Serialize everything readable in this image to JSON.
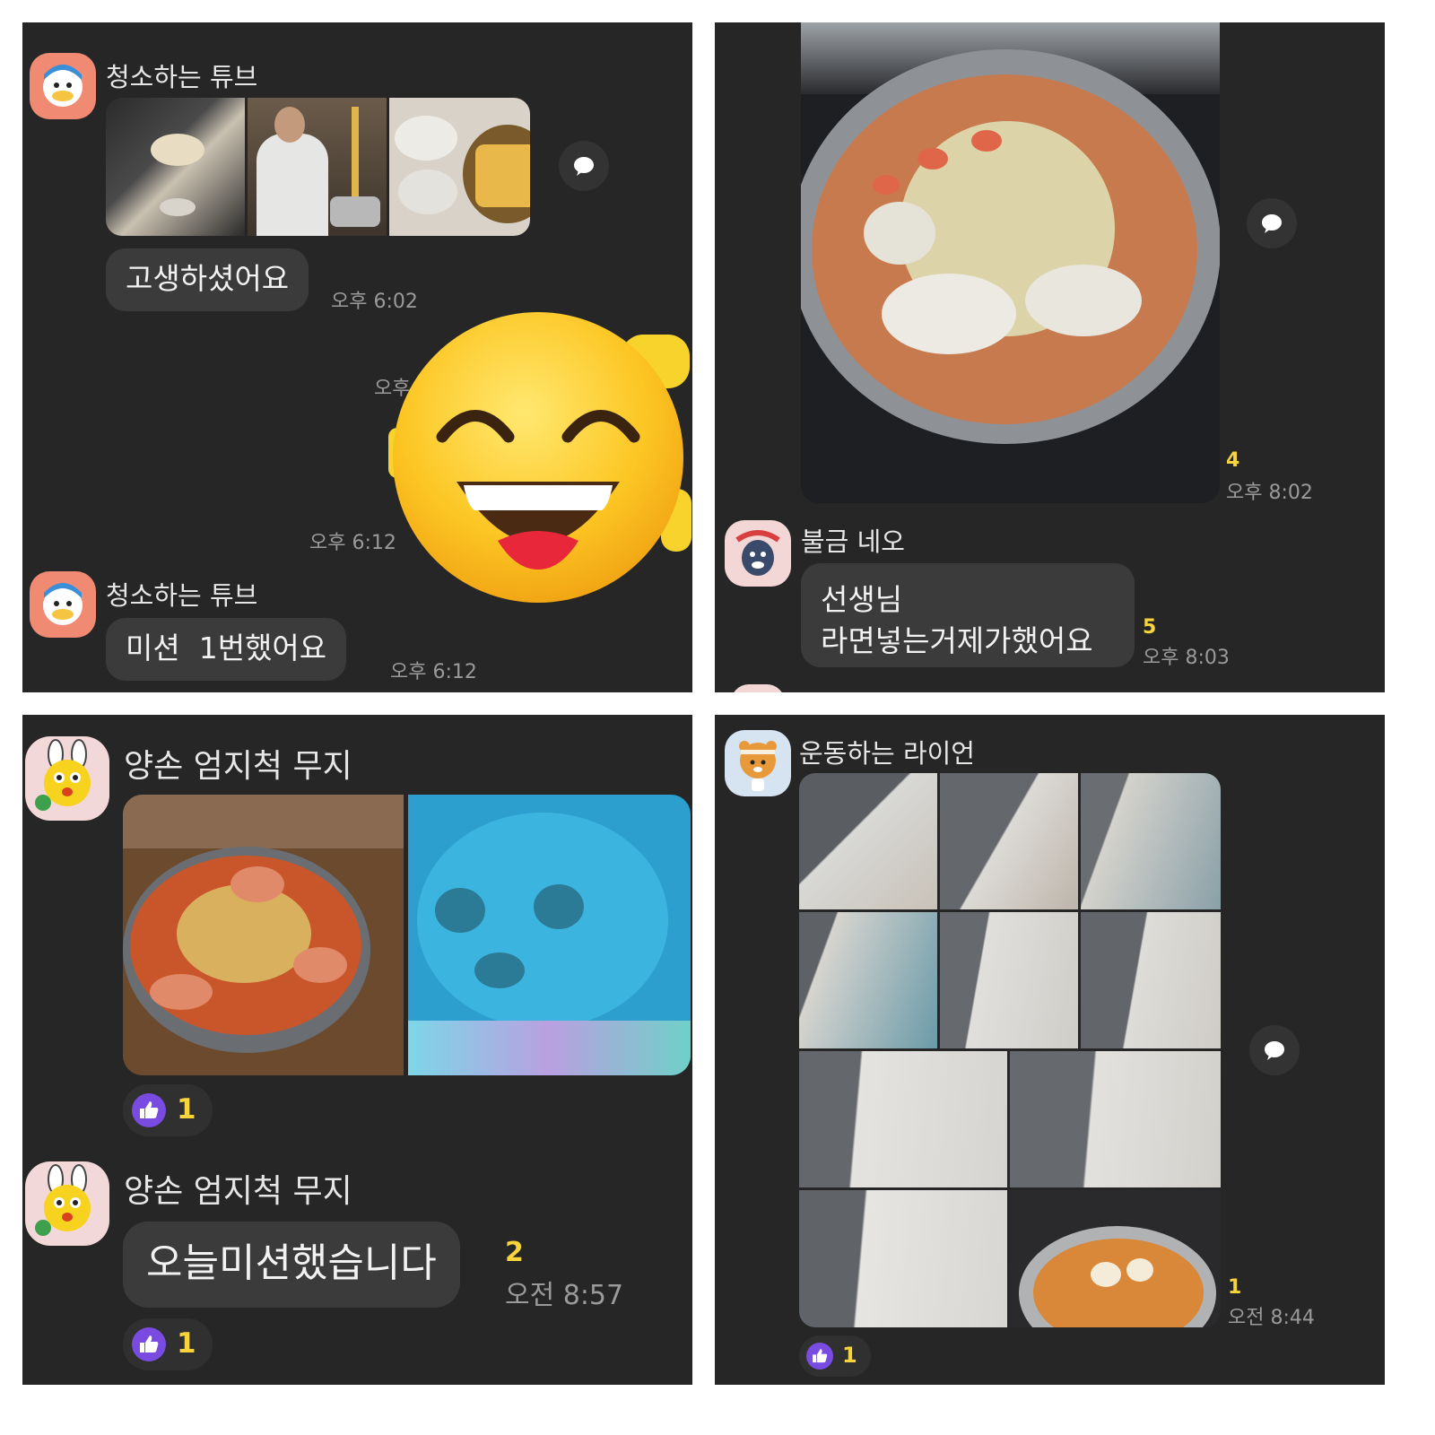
{
  "panel_tl": {
    "sender_1": "청소하는 튜브",
    "bubble_1": "고생하셨어요",
    "time_1": "오후 6:02",
    "time_2": "오후",
    "time_3": "오후 6:12",
    "sender_2": "청소하는 튜브",
    "bubble_2": "미션  1번했어요",
    "time_4": "오후 6:12"
  },
  "panel_tr": {
    "unread_1": "4",
    "time_1": "오후 8:02",
    "sender_1": "불금 네오",
    "bubble_line_1": "선생님",
    "bubble_line_2": "라면넣는거제가했어요",
    "unread_2": "5",
    "time_2": "오후 8:03"
  },
  "panel_bl": {
    "sender_1": "양손 엄지척 무지",
    "reaction_count_1": "1",
    "sender_2": "양손 엄지척 무지",
    "bubble_1": "오늘미션했습니다",
    "unread_1": "2",
    "time_1": "오전 8:57",
    "reaction_count_2": "1"
  },
  "panel_br": {
    "sender_1": "운동하는 라이언",
    "unread_1": "1",
    "time_1": "오전 8:44",
    "reaction_count_1": "1"
  },
  "icons": {
    "share": "speech-bubble-icon",
    "reaction": "thumbs-up-icon",
    "emoji": "laughing-face-emoji"
  },
  "colors": {
    "background": "#262626",
    "bubble": "#3b3b3b",
    "unread": "#f7d43c",
    "reaction": "#7a4be0"
  }
}
